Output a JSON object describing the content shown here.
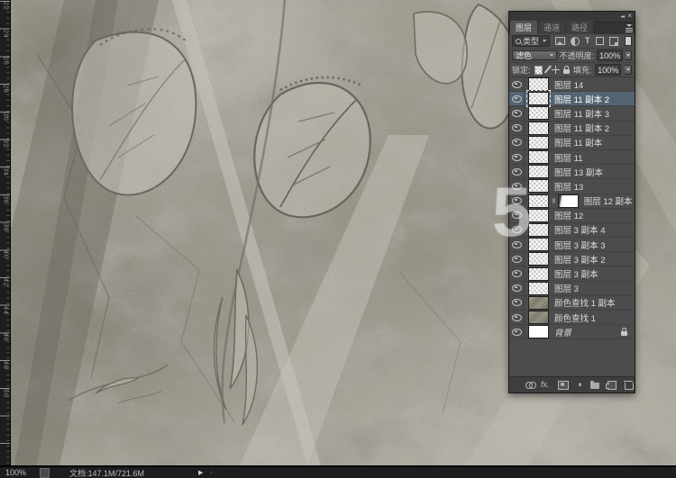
{
  "window": {
    "zoom_level": "100%",
    "doc_info": "文档:147.1M/721.6M",
    "status_arrow": "▶"
  },
  "watermark": "5",
  "ruler": {
    "labels": [
      "22",
      "24",
      "26",
      "28",
      "30",
      "32",
      "34",
      "36",
      "38",
      "40",
      "42",
      "44",
      "46",
      "48",
      "50"
    ]
  },
  "layers_panel": {
    "title_icons": {
      "collapse": "◂◂",
      "close": "×"
    },
    "tabs": [
      {
        "label": "图层"
      },
      {
        "label": "通道"
      },
      {
        "label": "路径"
      }
    ],
    "filter": {
      "search_label": "类型"
    },
    "blend": {
      "mode": "滤色",
      "opacity_label": "不透明度:",
      "opacity_value": "100%"
    },
    "lock": {
      "label": "锁定:",
      "fill_label": "填充:",
      "fill_value": "100%"
    },
    "layers": [
      {
        "name": "图层 14",
        "thumb": "checker"
      },
      {
        "name": "图层 11 副本 2",
        "thumb": "checker",
        "selected": true
      },
      {
        "name": "图层 11 副本 3",
        "thumb": "checker"
      },
      {
        "name": "图层 11 副本 2",
        "thumb": "checker"
      },
      {
        "name": "图层 11 副本",
        "thumb": "checker"
      },
      {
        "name": "图层 11",
        "thumb": "checker"
      },
      {
        "name": "图层 13 副本",
        "thumb": "checker"
      },
      {
        "name": "图层 13",
        "thumb": "checker"
      },
      {
        "name": "图层 12 副本",
        "thumb": "checker",
        "mask": true
      },
      {
        "name": "图层 12",
        "thumb": "checker"
      },
      {
        "name": "图层 3 副本 4",
        "thumb": "checker"
      },
      {
        "name": "图层 3 副本 3",
        "thumb": "checker"
      },
      {
        "name": "图层 3 副本 2",
        "thumb": "checker"
      },
      {
        "name": "图层 3 副本",
        "thumb": "checker"
      },
      {
        "name": "图层 3",
        "thumb": "checker"
      },
      {
        "name": "颜色查找 1 副本",
        "thumb": "texture"
      },
      {
        "name": "颜色查找 1",
        "thumb": "texture"
      },
      {
        "name": "背景",
        "thumb": "white",
        "locked": true,
        "italic": true
      }
    ],
    "bottom_bar_fx_label": "fx."
  },
  "colors": {
    "panel_bg": "#4d4d4d",
    "selected_row": "#556473",
    "statusbar_bg": "#1d1d1d",
    "canvas_base": "#b3afa3"
  }
}
